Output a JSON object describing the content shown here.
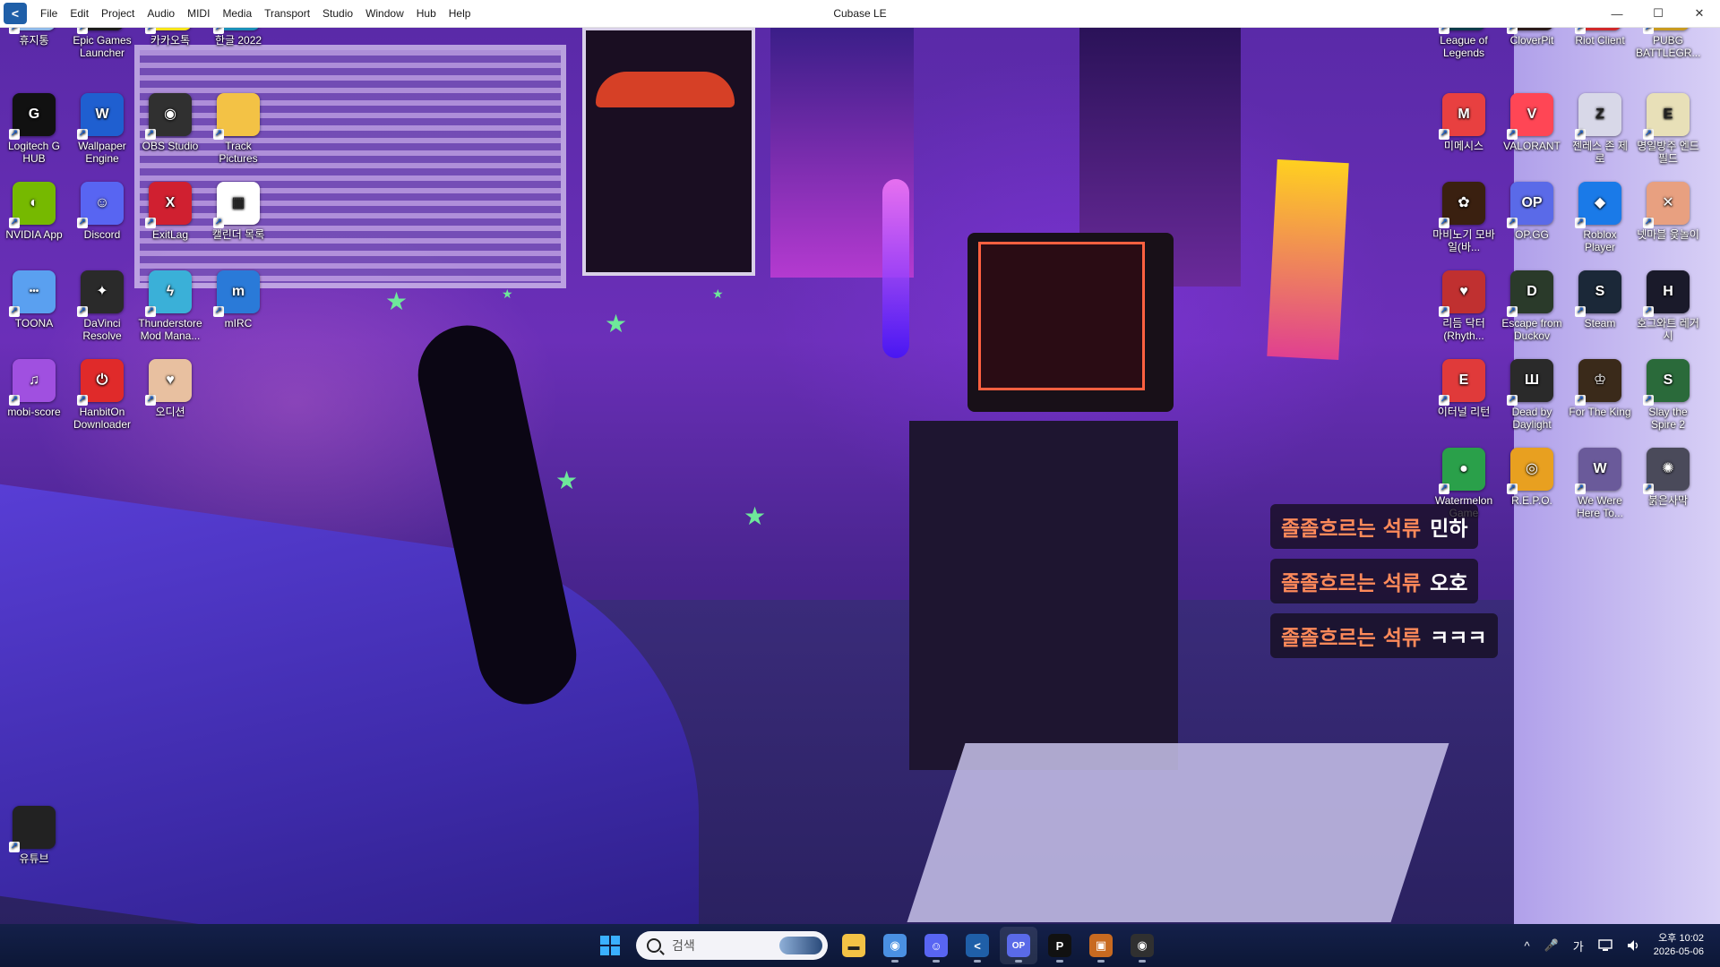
{
  "window": {
    "title": "Cubase LE",
    "logo_glyph": "<",
    "menu": [
      "File",
      "Edit",
      "Project",
      "Audio",
      "MIDI",
      "Media",
      "Transport",
      "Studio",
      "Window",
      "Hub",
      "Help"
    ],
    "controls": {
      "minimize": "—",
      "maximize": "☐",
      "close": "✕"
    }
  },
  "desktop": {
    "left_icons": [
      {
        "label": "휴지통",
        "icon": "recycle-bin-icon",
        "color": "#8fb8e8",
        "glyph": "🗑"
      },
      {
        "label": "Epic Games Launcher",
        "icon": "epic-games-icon",
        "color": "#1b1b1b",
        "glyph": "EPIC"
      },
      {
        "label": "카카오톡",
        "icon": "kakaotalk-icon",
        "color": "#f7e21a",
        "glyph": "TALK"
      },
      {
        "label": "한글 2022",
        "icon": "hangul-icon",
        "color": "#1a8fb8",
        "glyph": "ㅎ"
      },
      {
        "label": "Logitech G HUB",
        "icon": "logitech-g-icon",
        "color": "#111111",
        "glyph": "G"
      },
      {
        "label": "Wallpaper Engine",
        "icon": "wallpaper-engine-icon",
        "color": "#1f5fd0",
        "glyph": "W"
      },
      {
        "label": "OBS Studio",
        "icon": "obs-icon",
        "color": "#303030",
        "glyph": "◉"
      },
      {
        "label": "Track Pictures",
        "icon": "folder-icon",
        "color": "#f3c245",
        "glyph": ""
      },
      {
        "label": "NVIDIA App",
        "icon": "nvidia-icon",
        "color": "#76b900",
        "glyph": "◐"
      },
      {
        "label": "Discord",
        "icon": "discord-icon",
        "color": "#5865f2",
        "glyph": "☺"
      },
      {
        "label": "ExitLag",
        "icon": "exitlag-icon",
        "color": "#d02030",
        "glyph": "X"
      },
      {
        "label": "캘린더 목록",
        "icon": "calendar-icon",
        "color": "#ffffff",
        "glyph": "▦"
      },
      {
        "label": "TOONA",
        "icon": "toona-icon",
        "color": "#5aa0f0",
        "glyph": "•••"
      },
      {
        "label": "DaVinci Resolve",
        "icon": "davinci-icon",
        "color": "#2a2a2a",
        "glyph": "✦"
      },
      {
        "label": "Thunderstore Mod Mana...",
        "icon": "thunderstore-icon",
        "color": "#3ab0d8",
        "glyph": "ϟ"
      },
      {
        "label": "mIRC",
        "icon": "mirc-icon",
        "color": "#2a7ad8",
        "glyph": "m"
      },
      {
        "label": "mobi-score",
        "icon": "mobi-score-icon",
        "color": "#a050e0",
        "glyph": "♫"
      },
      {
        "label": "HanbitOn Downloader",
        "icon": "hanbiton-icon",
        "color": "#e02a2a",
        "glyph": "⏻"
      },
      {
        "label": "오디션",
        "icon": "audition-icon",
        "color": "#e8c0a0",
        "glyph": "♥"
      },
      {
        "label": "유튜브",
        "icon": "youtube-folder-icon",
        "color": "#222222",
        "glyph": ""
      }
    ],
    "right_icons": [
      {
        "label": "League of Legends",
        "icon": "league-icon",
        "color": "#0c3a4a",
        "glyph": "L"
      },
      {
        "label": "CloverPit",
        "icon": "cloverpit-icon",
        "color": "#2a1a1a",
        "glyph": "♣"
      },
      {
        "label": "Riot Client",
        "icon": "riot-client-icon",
        "color": "#d0282a",
        "glyph": "R"
      },
      {
        "label": "PUBG BATTLEGR...",
        "icon": "pubg-icon",
        "color": "#c89a20",
        "glyph": "P"
      },
      {
        "label": "미메시스",
        "icon": "mimesis-icon",
        "color": "#e84040",
        "glyph": "M"
      },
      {
        "label": "VALORANT",
        "icon": "valorant-icon",
        "color": "#ff4655",
        "glyph": "V"
      },
      {
        "label": "젠레스 존 제로",
        "icon": "zzz-icon",
        "color": "#d8d8e8",
        "glyph": "Z"
      },
      {
        "label": "명일방주 엔드필드",
        "icon": "endfield-icon",
        "color": "#e8e0b8",
        "glyph": "E"
      },
      {
        "label": "마비노기 모바일(바...",
        "icon": "mabinogi-icon",
        "color": "#3a2010",
        "glyph": "✿"
      },
      {
        "label": "OP.GG",
        "icon": "opgg-icon",
        "color": "#5a6ae8",
        "glyph": "OP"
      },
      {
        "label": "Roblox Player",
        "icon": "roblox-icon",
        "color": "#1a7ae8",
        "glyph": "◆"
      },
      {
        "label": "넷마블 윷놀이",
        "icon": "yutnori-icon",
        "color": "#e8a080",
        "glyph": "✕"
      },
      {
        "label": "리듬 닥터 (Rhyth...",
        "icon": "rhythm-doctor-icon",
        "color": "#c03030",
        "glyph": "♥"
      },
      {
        "label": "Escape from Duckov",
        "icon": "duckov-icon",
        "color": "#2a3a2a",
        "glyph": "D"
      },
      {
        "label": "Steam",
        "icon": "steam-icon",
        "color": "#1b2838",
        "glyph": "S"
      },
      {
        "label": "호그와트 레거시",
        "icon": "hogwarts-icon",
        "color": "#1a1a2a",
        "glyph": "H"
      },
      {
        "label": "이터널 리턴",
        "icon": "eternal-return-icon",
        "color": "#e03a3a",
        "glyph": "E"
      },
      {
        "label": "Dead by Daylight",
        "icon": "dbd-icon",
        "color": "#2a2a2a",
        "glyph": "Ш"
      },
      {
        "label": "For The King",
        "icon": "for-the-king-icon",
        "color": "#3a2a1a",
        "glyph": "♔"
      },
      {
        "label": "Slay the Spire 2",
        "icon": "slay-the-spire-icon",
        "color": "#2a6a3a",
        "glyph": "S"
      },
      {
        "label": "Watermelon Game",
        "icon": "watermelon-icon",
        "color": "#2aa04a",
        "glyph": "●"
      },
      {
        "label": "R.E.P.O.",
        "icon": "repo-icon",
        "color": "#e8a020",
        "glyph": "◎"
      },
      {
        "label": "We Were Here To...",
        "icon": "we-were-here-icon",
        "color": "#6a5a9a",
        "glyph": "W"
      },
      {
        "label": "붉은사막",
        "icon": "crimson-desert-icon",
        "color": "#4a4a5a",
        "glyph": "✺"
      }
    ]
  },
  "chat": [
    {
      "name": "졸졸흐르는 석류",
      "message": "민하"
    },
    {
      "name": "졸졸흐르는 석류",
      "message": "오호"
    },
    {
      "name": "졸졸흐르는 석류",
      "message": "ㅋㅋㅋ"
    }
  ],
  "taskbar": {
    "search_placeholder": "검색",
    "apps": [
      {
        "name": "file-explorer",
        "icon": "folder-icon",
        "color": "#f3c245",
        "glyph": "▬",
        "active": false
      },
      {
        "name": "chrome",
        "icon": "chrome-icon",
        "color": "#4a90e2",
        "glyph": "◉",
        "active": true
      },
      {
        "name": "discord",
        "icon": "discord-icon",
        "color": "#5865f2",
        "glyph": "☺",
        "active": true
      },
      {
        "name": "cubase",
        "icon": "cubase-icon",
        "color": "#1f5fa8",
        "glyph": "<",
        "active": true
      },
      {
        "name": "opgg",
        "icon": "opgg-icon",
        "color": "#5a6ae8",
        "glyph": "OP",
        "active": true
      },
      {
        "name": "pixel-app",
        "icon": "p-app-icon",
        "color": "#111111",
        "glyph": "P",
        "active": true
      },
      {
        "name": "game-app",
        "icon": "game-icon",
        "color": "#c86a20",
        "glyph": "▣",
        "active": true
      },
      {
        "name": "obs",
        "icon": "obs-icon",
        "color": "#303030",
        "glyph": "◉",
        "active": true
      }
    ],
    "tray": {
      "chevron": "^",
      "mic": "🎤",
      "ime": "가",
      "network": "🖥",
      "volume": "🔊",
      "time": "오후 10:02",
      "date": "2026-05-06"
    }
  }
}
